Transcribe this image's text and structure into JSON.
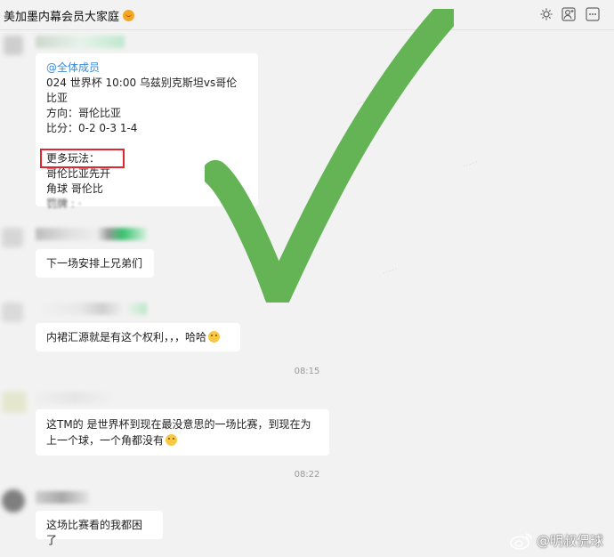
{
  "titlebar": {
    "title": "美加墨内幕会员大家庭",
    "title_emoji": "emoji-face",
    "icons": [
      "gear-icon",
      "add-user-icon",
      "more-icon"
    ]
  },
  "messages": [
    {
      "type": "announcement",
      "lines": [
        "@全体成员",
        "024 世界杯 10:00 乌兹别克斯坦vs哥伦比亚",
        "方向：哥伦比亚",
        "比分：0-2 0-3 1-4",
        "",
        "更多玩法：",
        "哥伦比亚先开",
        "角球 哥伦比",
        "罚牌 : ·"
      ]
    },
    {
      "type": "text",
      "text": "下一场安排上兄弟们"
    },
    {
      "type": "text",
      "text": "内裙汇源就是有这个权利，，，哈哈"
    },
    {
      "type": "text",
      "text": "这TM的  是世界杯到现在最没意思的一场比赛，到现在为上一个球，一个角都没有"
    },
    {
      "type": "text",
      "text": "这场比赛看的我都困了"
    }
  ],
  "timestamps": [
    "08:15",
    "08:22"
  ],
  "overlay": {
    "checkmark_color": "#5cb04d",
    "highlight_color": "#e0262e"
  },
  "watermark_bottom": {
    "text": "@明叔侃球",
    "icon": "weibo-icon"
  }
}
